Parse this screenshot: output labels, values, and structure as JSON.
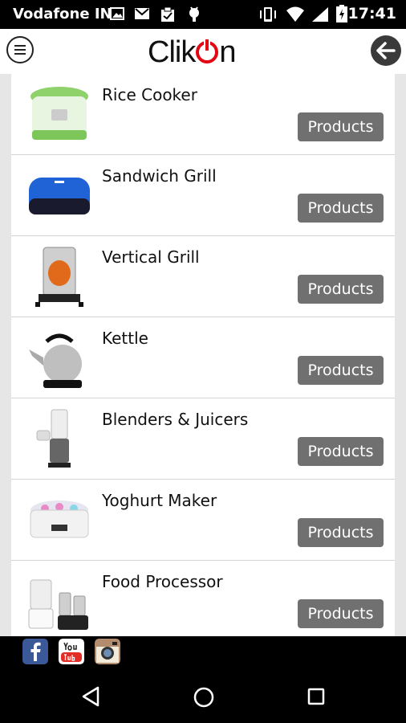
{
  "status_bar": {
    "carrier": "Vodafone IN",
    "time": "17:41"
  },
  "header": {
    "logo_text_left": "Clik",
    "logo_text_right": "n",
    "menu_icon": "hamburger-icon",
    "back_icon": "arrow-left-icon"
  },
  "categories": [
    {
      "name": "Rice Cooker",
      "button": "Products"
    },
    {
      "name": "Sandwich Grill",
      "button": "Products"
    },
    {
      "name": "Vertical Grill",
      "button": "Products"
    },
    {
      "name": "Kettle",
      "button": "Products"
    },
    {
      "name": "Blenders & Juicers",
      "button": "Products"
    },
    {
      "name": "Yoghurt Maker",
      "button": "Products"
    },
    {
      "name": "Food Processor",
      "button": "Products"
    }
  ],
  "social": [
    "facebook-icon",
    "youtube-icon",
    "instagram-icon"
  ],
  "colors": {
    "brand_red": "#e30613",
    "button_gray": "#707070"
  }
}
